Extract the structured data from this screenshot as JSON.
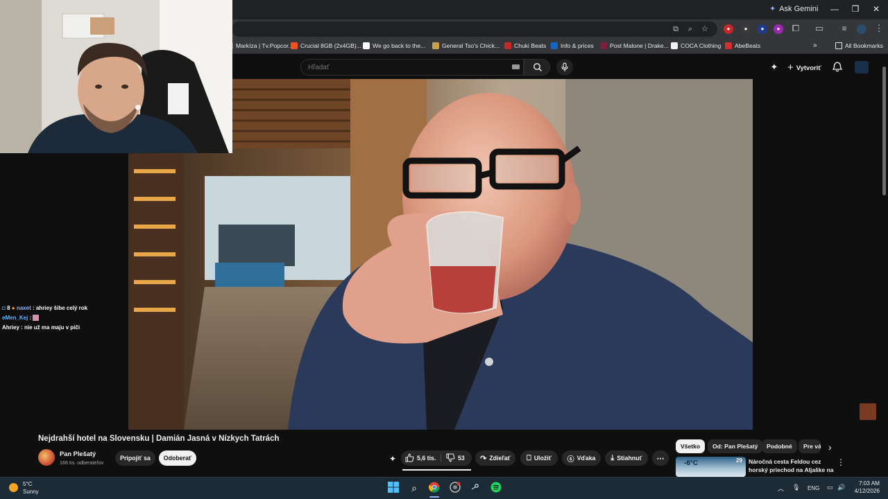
{
  "browser": {
    "ask_gemini_label": "Ask Gemini",
    "bookmarks": [
      {
        "label": "Markíza | Tv.Popcor...",
        "color": "#e53935"
      },
      {
        "label": "Crucial 8GB (2x4GB)...",
        "color": "#f4511e"
      },
      {
        "label": "We go back to the...",
        "color": "#ffffff"
      },
      {
        "label": "General Tso's Chick...",
        "color": "#c8a14b"
      },
      {
        "label": "Chuki Beats",
        "color": "#c62828"
      },
      {
        "label": "Info & prices",
        "color": "#1565c0"
      },
      {
        "label": "Post Malone | Drake...",
        "color": "#7b1f3a"
      },
      {
        "label": "COCA Clothing",
        "color": "#f1f1f1"
      },
      {
        "label": "AbeBeats",
        "color": "#d32f2f"
      }
    ],
    "all_bookmarks_label": "All Bookmarks"
  },
  "youtube": {
    "search_placeholder": "Hľadať",
    "create_label": "Vytvoriť",
    "video_title": "Nejdrahší hotel na Slovensku | Damián Jasná v Nízkych Tatrách",
    "channel_name": "Pan Plešatý",
    "subscriber_count": "166 tis. odberateľov",
    "join_label": "Pripojiť sa",
    "subscribe_label": "Odoberať",
    "like_count": "5,6 tis.",
    "dislike_count": "53",
    "share_label": "Zdieľať",
    "save_label": "Uložiť",
    "thanks_label": "Vďaka",
    "download_label": "Stiahnuť",
    "chips": [
      "Všetko",
      "Od: Pan Plešatý",
      "Podobné",
      "Pre vá"
    ],
    "recommendation": {
      "title": "Náročná cesta Feldou cez horský priechod na Aljaške na ...",
      "badge": "29",
      "thumb_text": "-6°C"
    }
  },
  "chat": {
    "lines": [
      {
        "user": "naxet",
        "message": "ahriey šibe celý rok"
      },
      {
        "user": "eMen_Kej",
        "message": ""
      },
      {
        "user": "Ahriey",
        "message": "nie už ma maju v piči"
      }
    ],
    "badges": "8"
  },
  "taskbar": {
    "weather_temp": "5°C",
    "weather_desc": "Sunny",
    "language": "ENG",
    "time": "7:03 AM",
    "date": "4/12/2026"
  },
  "colors": {
    "youtube_bg": "#0f0f0f",
    "chrome_dark": "#202124",
    "taskbar": "#1c2b36"
  }
}
